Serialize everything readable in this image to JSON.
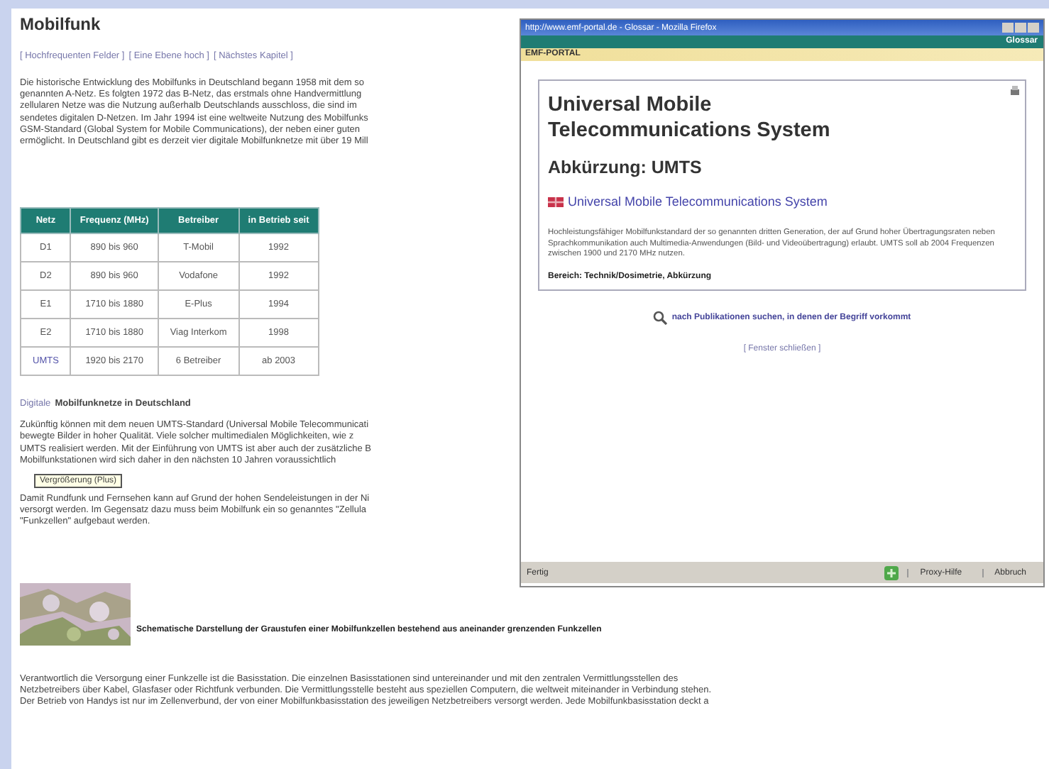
{
  "page": {
    "title": "Mobilfunk",
    "nav_links": [
      "[ Hochfrequenten Felder ]",
      "[ Eine Ebene hoch ]",
      "[ Nächstes Kapitel ]"
    ],
    "intro_lines": [
      "Die historische Entwicklung des Mobilfunks in Deutschland begann 1958 mit dem so",
      "genannten A-Netz. Es folgten 1972 das B-Netz, das erstmals ohne Handvermittlung",
      "zellularen Netze was die Nutzung außerhalb Deutschlands ausschloss, die sind im",
      "sendetes digitalen D-Netzen. Im Jahr 1994 ist eine weltweite Nutzung des Mobilfunks",
      "GSM-Standard (Global System for Mobile Communications), der neben einer guten",
      "ermöglicht. In Deutschland gibt es derzeit vier digitale Mobilfunknetze mit über 19 Mill"
    ],
    "table": {
      "columns": [
        "Netz",
        "Frequenz (MHz)",
        "Betreiber",
        "in Betrieb seit"
      ],
      "rows": [
        [
          "D1",
          "890 bis 960",
          "T-Mobil",
          "1992"
        ],
        [
          "D2",
          "890 bis 960",
          "Vodafone",
          "1992"
        ],
        [
          "E1",
          "1710 bis 1880",
          "E-Plus",
          "1994"
        ],
        [
          "E2",
          "1710 bis 1880",
          "Viag Interkom",
          "1998"
        ],
        [
          "UMTS",
          "1920 bis 2170",
          "6 Betreiber",
          "ab 2003"
        ]
      ]
    },
    "section_heading": {
      "link": "Digitale",
      "text": "Mobilfunknetze in Deutschland"
    },
    "para2_lines": [
      "Zukünftig können mit dem neuen UMTS-Standard (Universal Mobile Telecommunicati",
      "bewegte Bilder in hoher Qualität. Viele solcher multimedialen Möglichkeiten, wie z",
      "UMTS realisiert werden. Mit der Einführung von UMTS ist aber auch der zusätzliche B",
      "Mobilfunkstationen wird sich daher in den nächsten 10 Jahren voraussichtlich"
    ],
    "tooltip": "Vergrößerung (Plus)",
    "para3_lines": [
      "Damit Rundfunk und Fernsehen kann auf Grund der hohen Sendeleistungen in der Ni",
      "versorgt werden. Im Gegensatz dazu muss beim Mobilfunk ein so genanntes \"Zellula",
      "\"Funkzellen\" aufgebaut werden."
    ],
    "figure": {
      "kind": "picture",
      "caption": "Schematische Darstellung der Graustufen einer Mobilfunkzellen bestehend aus aneinander grenzenden Funkzellen"
    },
    "final_lines": [
      "Verantwortlich die Versorgung einer Funkzelle ist die Basisstation. Die einzelnen Basisstationen sind untereinander und mit den zentralen Vermittlungsstellen des",
      "Netzbetreibers über Kabel, Glasfaser oder Richtfunk verbunden. Die Vermittlungsstelle besteht aus speziellen Computern, die weltweit miteinander in Verbindung stehen.",
      "Der Betrieb von Handys ist nur im Zellenverbund, der von einer Mobilfunkbasisstation des jeweiligen Netzbetreibers versorgt werden. Jede Mobilfunkbasisstation deckt a"
    ]
  },
  "popup": {
    "title": "http://www.emf-portal.de - Glossar - Mozilla Firefox",
    "section": "Glossar",
    "brand": "EMF-PORTAL",
    "heading": "Universal Mobile Telecommunications System",
    "abbreviation": "Abkürzung: UMTS",
    "english_link": "Universal Mobile Telecommunications System",
    "description": "Hochleistungsfähiger Mobilfunkstandard der so genannten dritten Generation, der auf Grund hoher Übertragungsraten neben Sprachkommunikation auch Multimedia-Anwendungen (Bild- und Videoübertragung) erlaubt. UMTS soll ab 2004 Frequenzen zwischen 1900 und 2170 MHz nutzen.",
    "category": "Bereich: Technik/Dosimetrie, Abkürzung",
    "search_link": "nach Publikationen suchen, in denen der Begriff vorkommt",
    "close_link": "[ Fenster schließen ]",
    "status": "Fertig",
    "status_fields": [
      "Proxy-Hilfe",
      "Abbruch"
    ]
  }
}
